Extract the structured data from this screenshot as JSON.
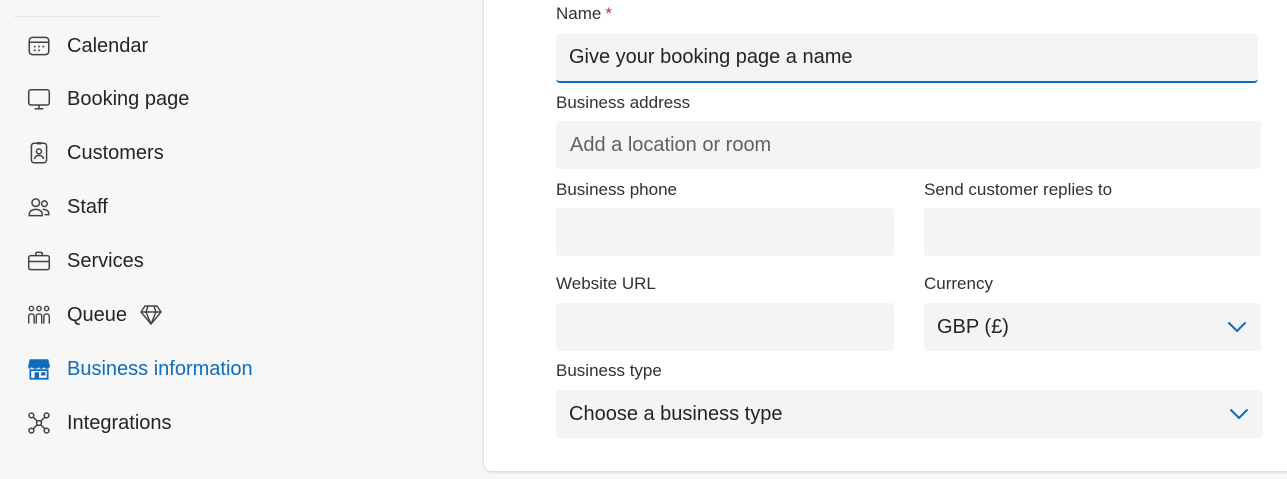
{
  "sidebar": {
    "items": [
      {
        "label": "Calendar",
        "icon": "calendar-icon"
      },
      {
        "label": "Booking page",
        "icon": "monitor-icon"
      },
      {
        "label": "Customers",
        "icon": "contact-card-icon"
      },
      {
        "label": "Staff",
        "icon": "people-icon"
      },
      {
        "label": "Services",
        "icon": "briefcase-icon"
      },
      {
        "label": "Queue",
        "icon": "people-queue-icon",
        "badge": "premium-diamond-icon"
      },
      {
        "label": "Business information",
        "icon": "storefront-icon",
        "active": true
      },
      {
        "label": "Integrations",
        "icon": "integrations-icon"
      }
    ]
  },
  "form": {
    "name_label": "Name",
    "name_required": "*",
    "name_placeholder": "Give your booking page a name",
    "address_label": "Business address",
    "address_placeholder": "Add a location or room",
    "phone_label": "Business phone",
    "phone_value": "",
    "replies_label": "Send customer replies to",
    "replies_value": "",
    "website_label": "Website URL",
    "website_value": "",
    "currency_label": "Currency",
    "currency_value": "GBP (£)",
    "type_label": "Business type",
    "type_value": "Choose a business type"
  },
  "colors": {
    "accent": "#0f6cbd",
    "required": "#c4314b",
    "field_bg": "#f4f4f4"
  }
}
